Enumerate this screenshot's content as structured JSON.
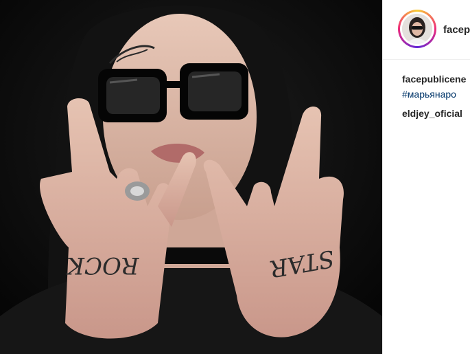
{
  "post": {
    "image_alt": "Photo of a person with tattooed hands showing rock gestures",
    "hand_tattoo_left": "ROCK",
    "hand_tattoo_right": "STAR"
  },
  "header": {
    "username": "facep"
  },
  "comments": [
    {
      "username": "facepublicene",
      "text": "#марьянаро"
    },
    {
      "username": "eldjey_oficial",
      "text": ""
    }
  ]
}
